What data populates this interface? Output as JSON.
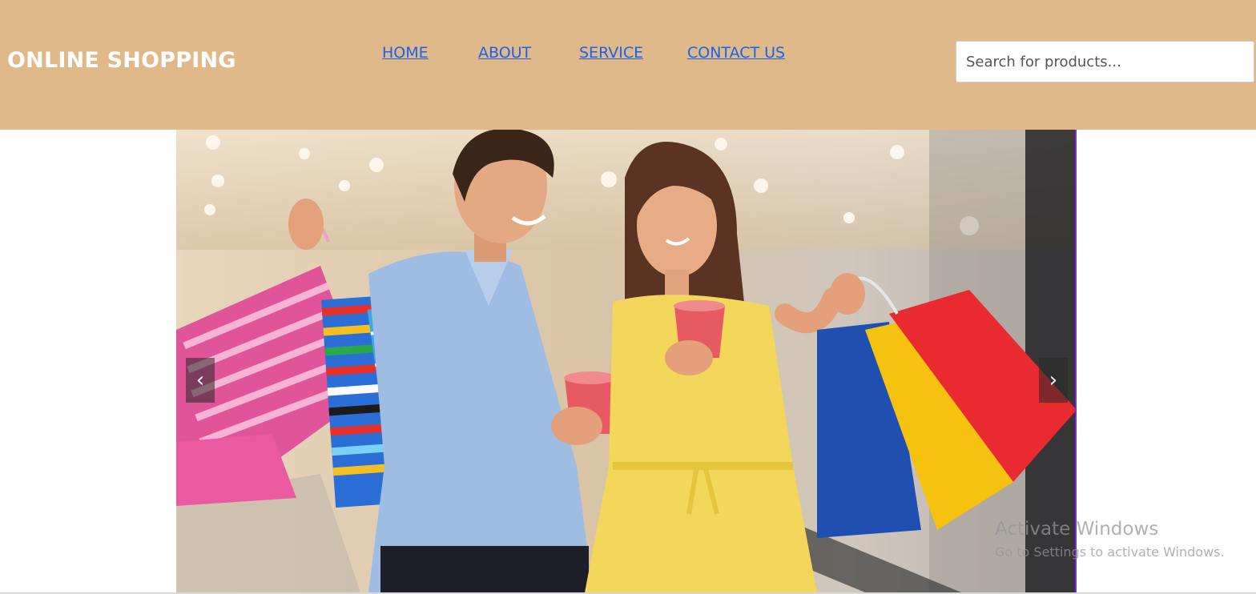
{
  "header": {
    "brand": "ONLINE SHOPPING",
    "nav": [
      {
        "label": "HOME"
      },
      {
        "label": "ABOUT"
      },
      {
        "label": "SERVICE"
      },
      {
        "label": "CONTACT US"
      }
    ],
    "search": {
      "placeholder": "Search for products...",
      "value": ""
    }
  },
  "carousel": {
    "prev_label": "‹",
    "next_label": "›",
    "slide_subject": "couple-shopping-photo"
  },
  "watermark": {
    "title": "Activate Windows",
    "subtitle": "Go to Settings to activate Windows."
  },
  "colors": {
    "header_bg": "#e0b98b",
    "brand_text": "#ffffff",
    "nav_link": "#1a62e8"
  }
}
